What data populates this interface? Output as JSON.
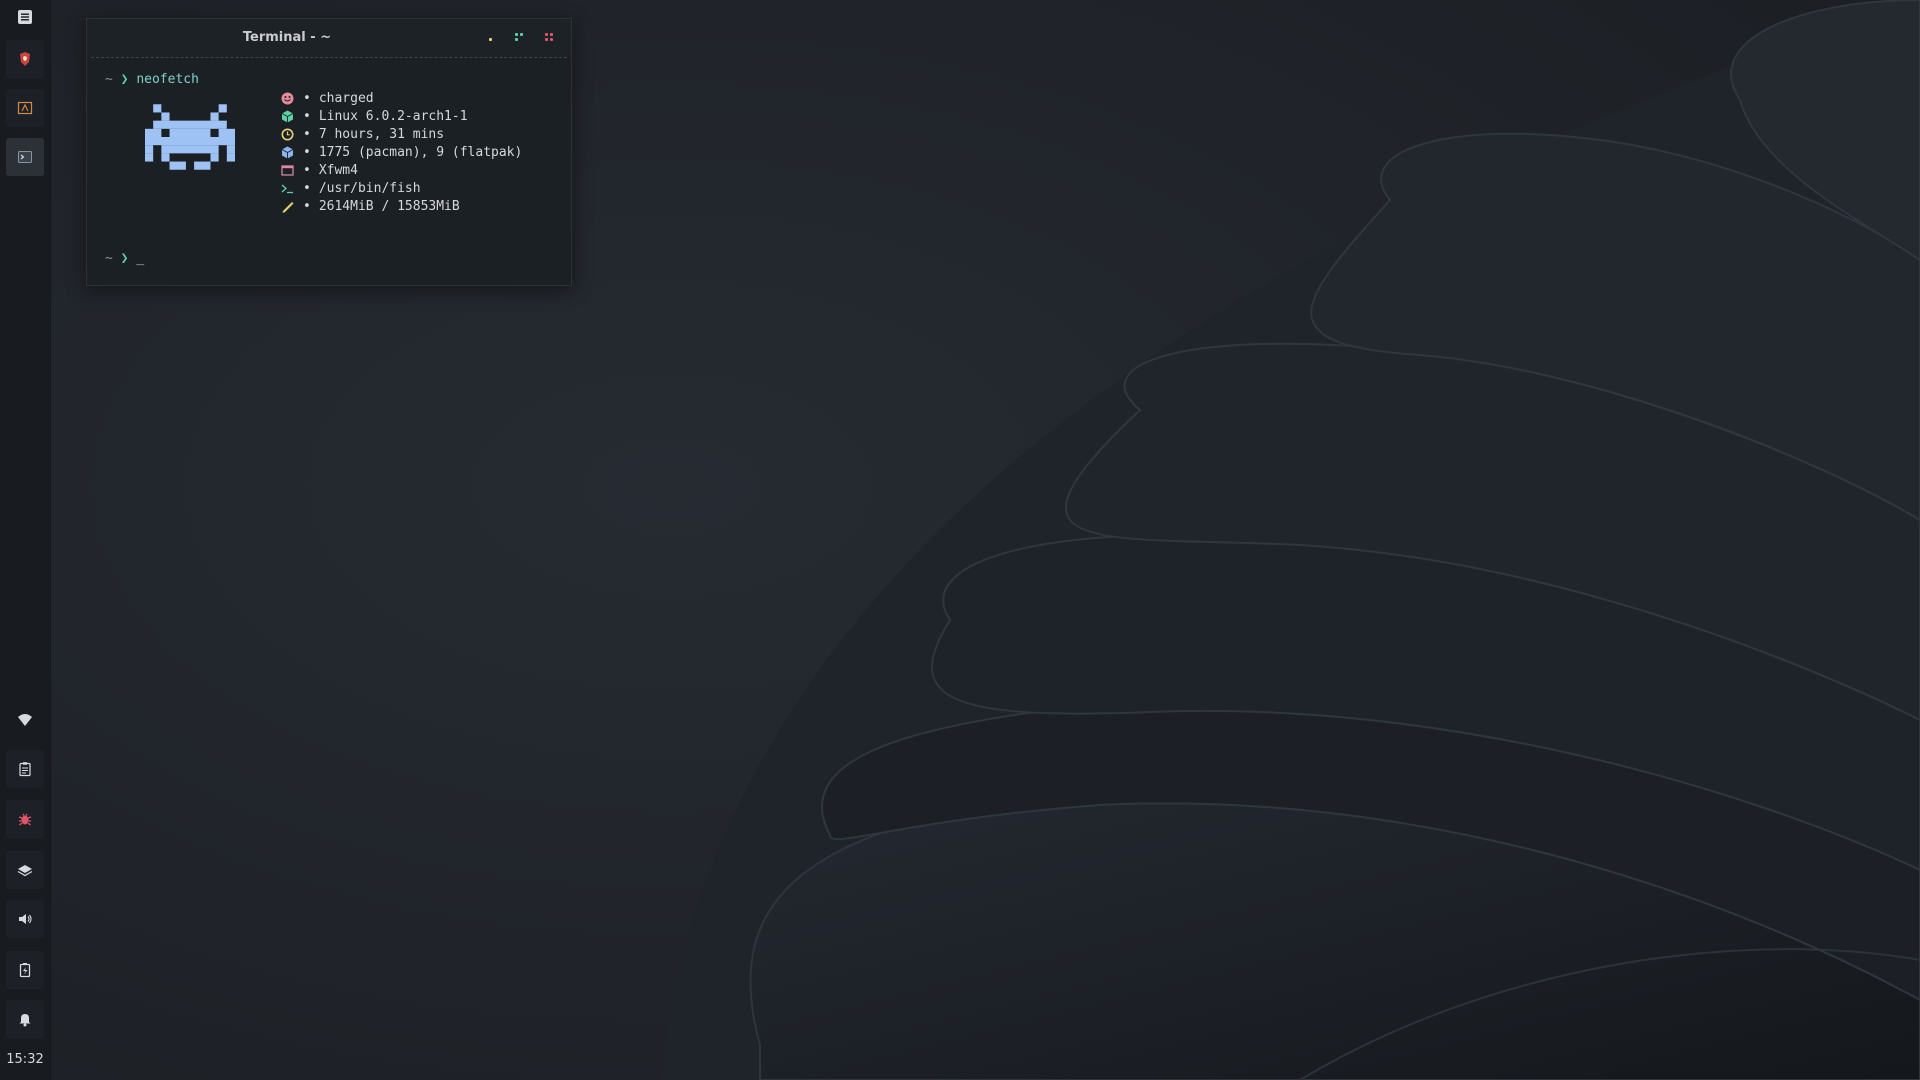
{
  "panel": {
    "launchers": [
      {
        "name": "menu",
        "icon": "menu-icon"
      },
      {
        "name": "browser",
        "icon": "brave-browser-icon"
      },
      {
        "name": "text-editor",
        "icon": "editor-icon"
      },
      {
        "name": "terminal",
        "icon": "terminal-icon",
        "active": true
      }
    ],
    "tray": [
      {
        "name": "network",
        "icon": "wifi-icon"
      },
      {
        "name": "clipboard",
        "icon": "clipboard-icon"
      },
      {
        "name": "bug-tracker",
        "icon": "bug-icon"
      },
      {
        "name": "layers",
        "icon": "layers-icon"
      },
      {
        "name": "volume",
        "icon": "volume-icon"
      },
      {
        "name": "battery",
        "icon": "battery-icon"
      },
      {
        "name": "notifications",
        "icon": "bell-icon"
      }
    ],
    "clock": "15:32"
  },
  "terminal": {
    "title": "Terminal - ~",
    "prompt_symbol": "~",
    "prompt_chevron": "❯",
    "command": "neofetch",
    "cursor": "_",
    "info": [
      {
        "icon": "battery-smile-icon",
        "color": "#e58a9a",
        "text": "charged"
      },
      {
        "icon": "arch-package-icon",
        "color": "#5fd0a8",
        "text": "Linux 6.0.2-arch1-1"
      },
      {
        "icon": "clock-icon",
        "color": "#e8d27a",
        "text": "7 hours, 31 mins"
      },
      {
        "icon": "package-icon",
        "color": "#8cb4f0",
        "text": "1775 (pacman), 9 (flatpak)"
      },
      {
        "icon": "window-icon",
        "color": "#e08aa8",
        "text": "Xfwm4"
      },
      {
        "icon": "shell-icon",
        "color": "#5fd0a8",
        "text": "/usr/bin/fish"
      },
      {
        "icon": "memory-icon",
        "color": "#e8d27a",
        "text": "2614MiB / 15853MiB"
      }
    ],
    "bullet": "•",
    "logo_color": "#9fc2f5"
  },
  "colors": {
    "accent_green": "#5fd0a8",
    "panel_bg": "#181b20",
    "terminal_bg": "#1b2024"
  }
}
